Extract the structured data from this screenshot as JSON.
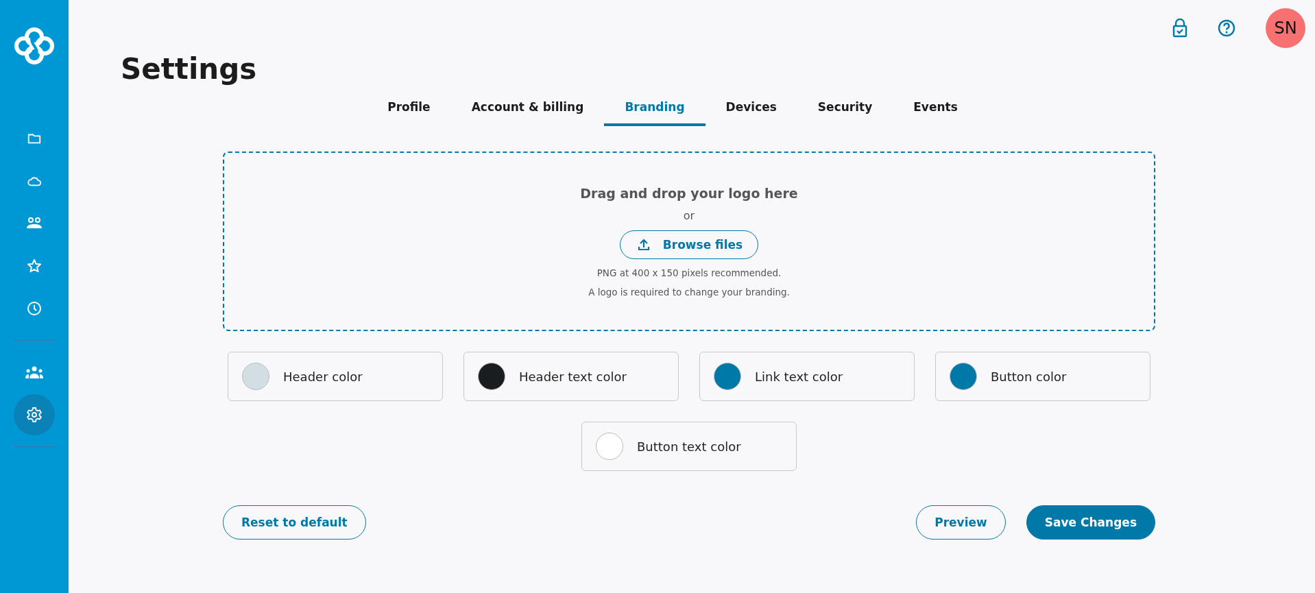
{
  "sidebar": {
    "items": [
      {
        "kind": "folder",
        "selected": false
      },
      {
        "kind": "cloud",
        "selected": false
      },
      {
        "kind": "people",
        "selected": false
      },
      {
        "kind": "star",
        "selected": false
      },
      {
        "kind": "clock",
        "selected": false
      },
      {
        "kind": "team",
        "selected": false
      },
      {
        "kind": "gear",
        "selected": true
      }
    ]
  },
  "header": {
    "avatar": "SN"
  },
  "title": "Settings",
  "tabs": [
    {
      "label": "Profile",
      "selected": false
    },
    {
      "label": "Account & billing",
      "selected": false
    },
    {
      "label": "Branding",
      "selected": true
    },
    {
      "label": "Devices",
      "selected": false
    },
    {
      "label": "Security",
      "selected": false
    },
    {
      "label": "Events",
      "selected": false
    }
  ],
  "dropzone": {
    "heading": "Drag and drop your logo here",
    "or": "or",
    "button": "Browse files",
    "hint": "PNG at 400 x 150 pixels recommended.",
    "note": "A logo is required to change your branding."
  },
  "colors": [
    {
      "label": "Header color",
      "color": "#d3dee4"
    },
    {
      "label": "Header text color",
      "color": "#1a1d20"
    },
    {
      "label": "Link text color",
      "color": "#0079a8"
    },
    {
      "label": "Button color",
      "color": "#0079a8"
    },
    {
      "label": "Button text color",
      "color": "#ffffff"
    }
  ],
  "actions": {
    "reset": "Reset to default",
    "preview": "Preview",
    "save": "Save Changes"
  }
}
